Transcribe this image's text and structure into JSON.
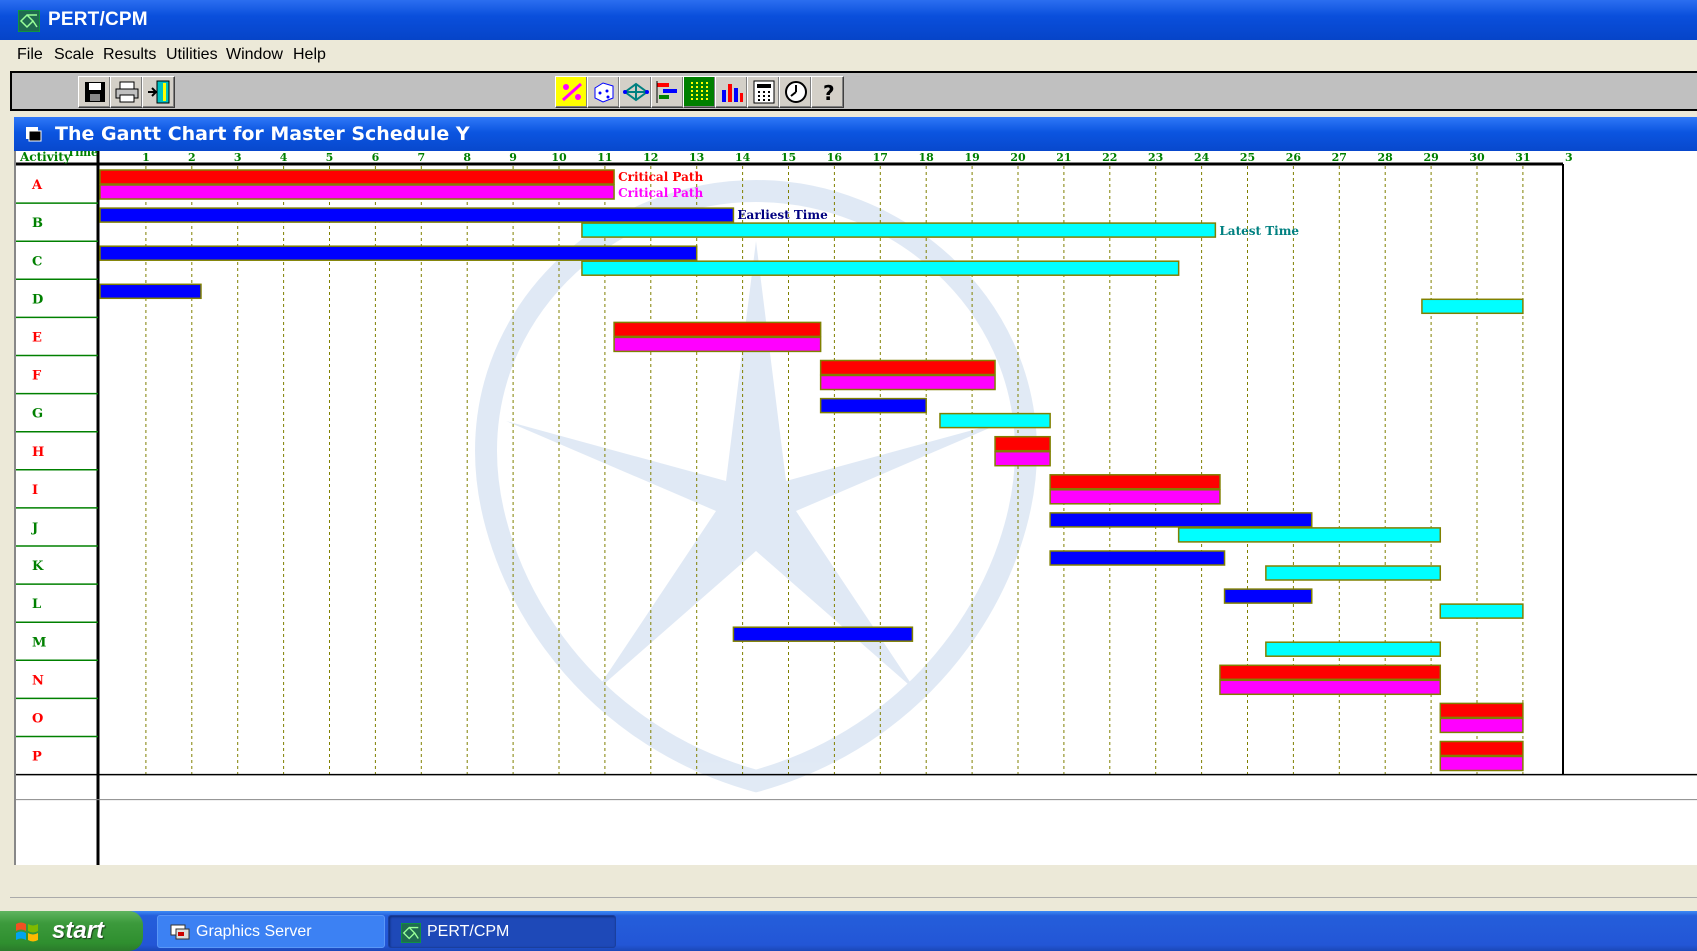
{
  "window": {
    "title": "PERT/CPM"
  },
  "menu": {
    "items": [
      "File",
      "Scale",
      "Results",
      "Utilities",
      "Window",
      "Help"
    ]
  },
  "toolbar": {
    "left_buttons": [
      "save-icon",
      "print-icon",
      "exit-door-icon"
    ],
    "right_buttons": [
      "solve-percent-icon",
      "dice-simulation-icon",
      "network-diagram-icon",
      "gantt-chart-icon",
      "grid-table-icon",
      "bar-chart-icon",
      "calculator-icon",
      "clock-icon",
      "help-icon"
    ]
  },
  "child_window": {
    "title": "The Gantt Chart for Master Schedule Y"
  },
  "gantt": {
    "header": {
      "activity_label": "Activity",
      "time_label": "Time"
    },
    "time_ticks": [
      "1",
      "2",
      "3",
      "4",
      "5",
      "6",
      "7",
      "8",
      "9",
      "10",
      "11",
      "12",
      "13",
      "14",
      "15",
      "16",
      "17",
      "18",
      "19",
      "20",
      "21",
      "22",
      "23",
      "24",
      "25",
      "26",
      "27",
      "28",
      "29",
      "30",
      "31",
      "3"
    ],
    "legend": {
      "critical_path": "Critical Path",
      "earliest_time": "Earliest Time",
      "latest_time": "Latest Time"
    },
    "colors": {
      "critical_red": "#ff0000",
      "critical_magenta": "#ff00ff",
      "earliest_blue": "#0000ff",
      "latest_cyan": "#00ffff",
      "label_red": "#ff0000",
      "label_green": "#008000",
      "grid_line": "#808000"
    }
  },
  "chart_data": {
    "type": "gantt",
    "x_axis": {
      "label": "Time",
      "min": 0,
      "max": 31
    },
    "y_axis": {
      "label": "Activity"
    },
    "activities": [
      {
        "name": "A",
        "critical": true,
        "start": 0,
        "end": 11.2
      },
      {
        "name": "B",
        "critical": false,
        "early_start": 0,
        "early_end": 13.8,
        "late_start": 10.5,
        "late_end": 24.3
      },
      {
        "name": "C",
        "critical": false,
        "early_start": 0,
        "early_end": 13,
        "late_start": 10.5,
        "late_end": 23.5
      },
      {
        "name": "D",
        "critical": false,
        "early_start": 0,
        "early_end": 2.2,
        "late_start": 28.8,
        "late_end": 31
      },
      {
        "name": "E",
        "critical": true,
        "start": 11.2,
        "end": 15.7
      },
      {
        "name": "F",
        "critical": true,
        "start": 15.7,
        "end": 19.5
      },
      {
        "name": "G",
        "critical": false,
        "early_start": 15.7,
        "early_end": 18,
        "late_start": 18.3,
        "late_end": 20.7
      },
      {
        "name": "H",
        "critical": true,
        "start": 19.5,
        "end": 20.7
      },
      {
        "name": "I",
        "critical": true,
        "start": 20.7,
        "end": 24.4
      },
      {
        "name": "J",
        "critical": false,
        "early_start": 20.7,
        "early_end": 26.4,
        "late_start": 23.5,
        "late_end": 29.2
      },
      {
        "name": "K",
        "critical": false,
        "early_start": 20.7,
        "early_end": 24.5,
        "late_start": 25.4,
        "late_end": 29.2
      },
      {
        "name": "L",
        "critical": false,
        "early_start": 24.5,
        "early_end": 26.4,
        "late_start": 29.2,
        "late_end": 31
      },
      {
        "name": "M",
        "critical": false,
        "early_start": 13.8,
        "early_end": 17.7,
        "late_start": 25.4,
        "late_end": 29.2
      },
      {
        "name": "N",
        "critical": true,
        "start": 24.4,
        "end": 29.2
      },
      {
        "name": "O",
        "critical": true,
        "start": 29.2,
        "end": 31
      },
      {
        "name": "P",
        "critical": true,
        "start": 29.2,
        "end": 31
      }
    ],
    "label_colors": [
      "red",
      "green",
      "green",
      "green",
      "red",
      "red",
      "green",
      "red",
      "red",
      "green",
      "green",
      "green",
      "green",
      "red",
      "red",
      "red"
    ]
  },
  "taskbar": {
    "start_label": "start",
    "tasks": [
      {
        "label": "Graphics Server"
      },
      {
        "label": "PERT/CPM"
      }
    ]
  }
}
